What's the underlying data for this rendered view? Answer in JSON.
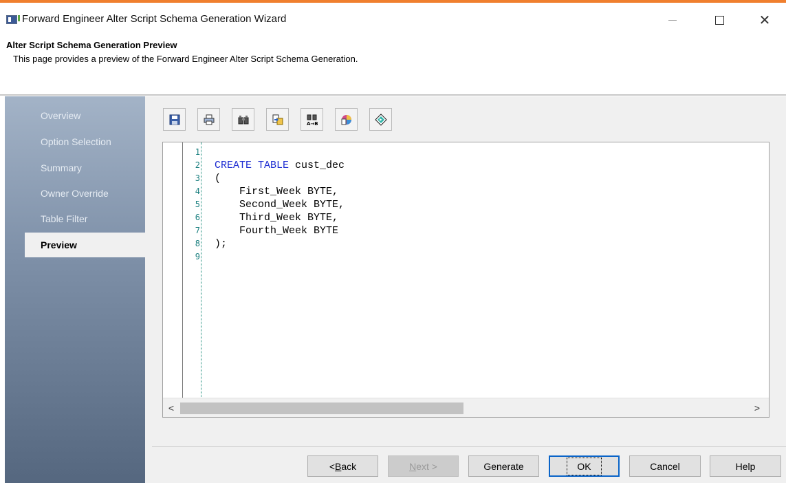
{
  "window": {
    "title": "Forward Engineer Alter Script Schema Generation Wizard",
    "accent_color": "#f07f2e"
  },
  "header": {
    "title": "Alter Script Schema Generation Preview",
    "description": "This page provides a preview of the Forward Engineer Alter Script Schema Generation."
  },
  "sidebar": {
    "items": [
      {
        "label": "Overview",
        "active": false
      },
      {
        "label": "Option Selection",
        "active": false
      },
      {
        "label": "Summary",
        "active": false
      },
      {
        "label": "Owner Override",
        "active": false
      },
      {
        "label": "Table Filter",
        "active": false
      },
      {
        "label": "Preview",
        "active": true
      }
    ]
  },
  "toolbar": {
    "buttons": [
      {
        "icon": "save-icon"
      },
      {
        "icon": "print-icon"
      },
      {
        "icon": "find-icon"
      },
      {
        "icon": "copy-to-clipboard-icon"
      },
      {
        "icon": "find-replace-icon"
      },
      {
        "icon": "color-options-icon"
      },
      {
        "icon": "goto-icon"
      }
    ]
  },
  "editor": {
    "line_numbers": [
      "1",
      "2",
      "3",
      "4",
      "5",
      "6",
      "7",
      "8",
      "9"
    ],
    "lines": [
      {
        "kw": "",
        "text": ""
      },
      {
        "kw": "CREATE TABLE",
        "text": " cust_dec"
      },
      {
        "kw": "",
        "text": "("
      },
      {
        "kw": "",
        "text": "    First_Week BYTE,"
      },
      {
        "kw": "",
        "text": "    Second_Week BYTE,"
      },
      {
        "kw": "",
        "text": "    Third_Week BYTE,"
      },
      {
        "kw": "",
        "text": "    Fourth_Week BYTE"
      },
      {
        "kw": "",
        "text": ");"
      },
      {
        "kw": "",
        "text": ""
      }
    ],
    "scroll_left": "<",
    "scroll_right": ">"
  },
  "buttons": {
    "back_underlined": "B",
    "back_prefix": "< ",
    "back_suffix": "ack",
    "next_underlined": "N",
    "next_suffix": "ext >",
    "generate": "Generate",
    "ok": "OK",
    "cancel": "Cancel",
    "help": "Help"
  }
}
